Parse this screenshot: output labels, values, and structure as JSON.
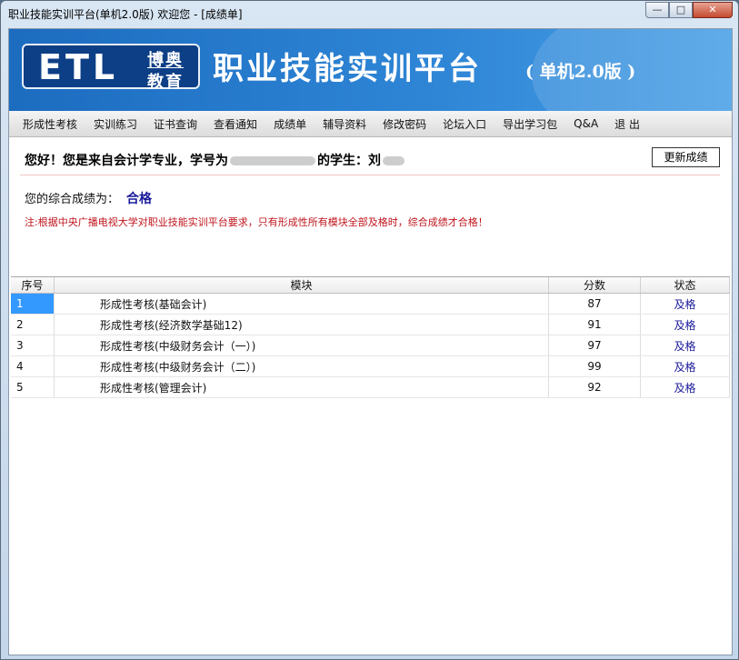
{
  "window": {
    "title": "职业技能实训平台(单机2.0版)   欢迎您 - [成绩单]",
    "buttons": {
      "minimize": "—",
      "maximize": "□",
      "close": "✕"
    }
  },
  "banner": {
    "logo_latin": "ETL",
    "logo_cn_top": "博奥",
    "logo_cn_bottom": "教育",
    "title": "职业技能实训平台",
    "subtitle": "( 单机2.0版 )"
  },
  "menu": {
    "items": [
      "形成性考核",
      "实训练习",
      "证书查询",
      "查看通知",
      "成绩单",
      "辅导资料",
      "修改密码",
      "论坛入口",
      "导出学习包",
      "Q&A",
      "退 出"
    ]
  },
  "greeting": {
    "prefix": "您好！您是来自会计学专业，学号为",
    "middle": "的学生：刘"
  },
  "refresh_button": "更新成绩",
  "score": {
    "label": "您的综合成绩为：",
    "value": "合格"
  },
  "note": "注:根据中央广播电视大学对职业技能实训平台要求，只有形成性所有模块全部及格时，综合成绩才合格！",
  "table": {
    "headers": [
      "序号",
      "模块",
      "分数",
      "状态"
    ],
    "rows": [
      {
        "no": "1",
        "module": "形成性考核(基础会计)",
        "score": "87",
        "status": "及格"
      },
      {
        "no": "2",
        "module": "形成性考核(经济数学基础12)",
        "score": "91",
        "status": "及格"
      },
      {
        "no": "3",
        "module": "形成性考核(中级财务会计（一）)",
        "score": "97",
        "status": "及格"
      },
      {
        "no": "4",
        "module": "形成性考核(中级财务会计（二）)",
        "score": "99",
        "status": "及格"
      },
      {
        "no": "5",
        "module": "形成性考核(管理会计)",
        "score": "92",
        "status": "及格"
      }
    ]
  }
}
